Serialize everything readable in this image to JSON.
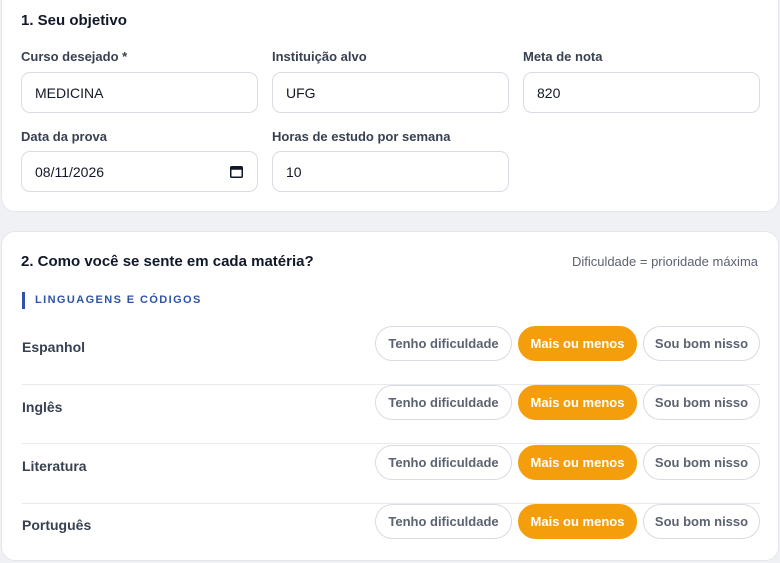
{
  "section1": {
    "title": "1. Seu objetivo",
    "fields": {
      "course": {
        "label": "Curso desejado *",
        "value": "MEDICINA"
      },
      "institution": {
        "label": "Instituição alvo",
        "value": "UFG"
      },
      "target_score": {
        "label": "Meta de nota",
        "value": "820"
      },
      "exam_date": {
        "label": "Data da prova",
        "value": "08/11/2026"
      },
      "study_hours": {
        "label": "Horas de estudo por semana",
        "value": "10"
      }
    }
  },
  "section2": {
    "title": "2. Como você se sente em cada matéria?",
    "hint": "Dificuldade = prioridade máxima",
    "group": "LINGUAGENS E CÓDIGOS",
    "options": {
      "hard": "Tenho dificuldade",
      "mid": "Mais ou menos",
      "good": "Sou bom nisso"
    },
    "subjects": [
      {
        "name": "Espanhol",
        "selected": "mid"
      },
      {
        "name": "Inglês",
        "selected": "mid"
      },
      {
        "name": "Literatura",
        "selected": "mid"
      },
      {
        "name": "Português",
        "selected": "mid"
      }
    ]
  },
  "colors": {
    "accent": "#f59e0b",
    "group_blue": "#2f53a6",
    "background": "#eff1f5"
  }
}
